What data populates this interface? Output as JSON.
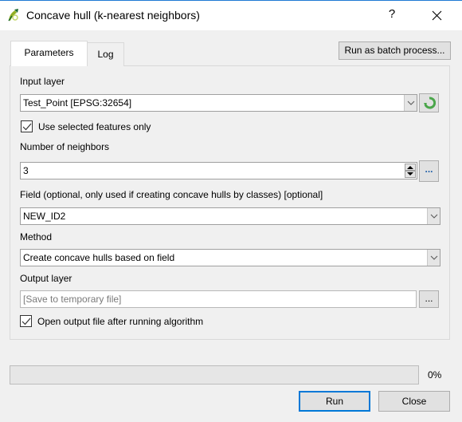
{
  "window": {
    "title": "Concave hull (k-nearest neighbors)",
    "help_label": "?",
    "app_icon": "qgis-logo-icon",
    "close_icon": "close-icon"
  },
  "toolbar": {
    "batch_label": "Run as batch process..."
  },
  "tabs": [
    {
      "label": "Parameters",
      "active": true
    },
    {
      "label": "Log",
      "active": false
    }
  ],
  "params": {
    "input_layer": {
      "label": "Input layer",
      "value": "Test_Point [EPSG:32654]",
      "iterate_icon": "iterate-refresh-icon"
    },
    "selected_only": {
      "label": "Use selected features only",
      "checked": true
    },
    "neighbors": {
      "label": "Number of neighbors",
      "value": "3",
      "more_label": "..."
    },
    "field": {
      "label": "Field (optional, only used if creating concave hulls by classes) [optional]",
      "value": "NEW_ID2"
    },
    "method": {
      "label": "Method",
      "value": "Create concave hulls based on field"
    },
    "output": {
      "label": "Output layer",
      "placeholder": "[Save to temporary file]",
      "browse_label": "..."
    },
    "open_output": {
      "label": "Open output file after running algorithm",
      "checked": true
    }
  },
  "progress": {
    "value_percent": 0,
    "text": "0%"
  },
  "buttons": {
    "run_label": "Run",
    "close_label": "Close"
  }
}
